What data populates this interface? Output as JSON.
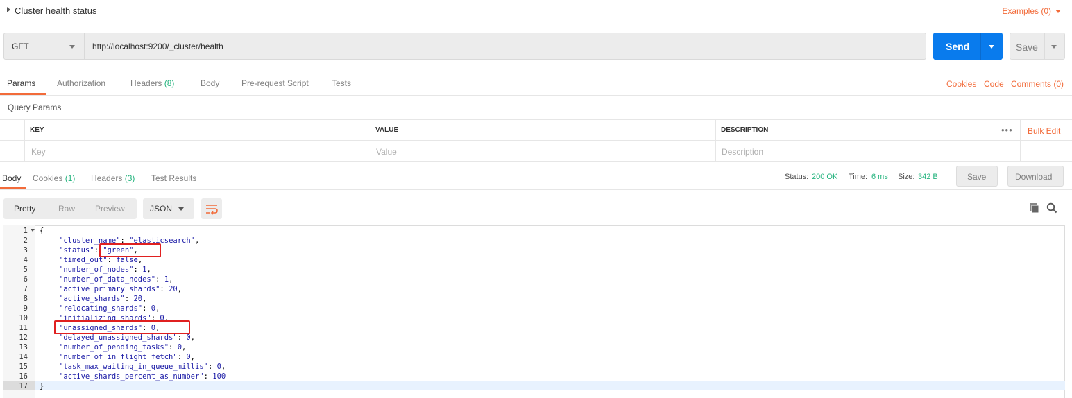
{
  "header": {
    "title": "Cluster health status",
    "examples": "Examples (0)"
  },
  "request": {
    "method": "GET",
    "url": "http://localhost:9200/_cluster/health",
    "send_label": "Send",
    "save_label": "Save"
  },
  "request_tabs": [
    {
      "label": "Params"
    },
    {
      "label": "Authorization"
    },
    {
      "label": "Headers",
      "count": "(8)"
    },
    {
      "label": "Body"
    },
    {
      "label": "Pre-request Script"
    },
    {
      "label": "Tests"
    }
  ],
  "request_links": {
    "cookies": "Cookies",
    "code": "Code",
    "comments": "Comments (0)"
  },
  "query_params": {
    "title": "Query Params",
    "columns": [
      "KEY",
      "VALUE",
      "DESCRIPTION"
    ],
    "placeholders": [
      "Key",
      "Value",
      "Description"
    ],
    "bulk_edit": "Bulk Edit",
    "more": "•••"
  },
  "response_tabs": [
    {
      "label": "Body"
    },
    {
      "label": "Cookies",
      "count": "(1)"
    },
    {
      "label": "Headers",
      "count": "(3)"
    },
    {
      "label": "Test Results"
    }
  ],
  "response_status": {
    "status_label": "Status:",
    "status": "200 OK",
    "time_label": "Time:",
    "time": "6 ms",
    "size_label": "Size:",
    "size": "342 B",
    "save_label": "Save",
    "download_label": "Download"
  },
  "view": {
    "options": [
      "Pretty",
      "Raw",
      "Preview"
    ],
    "active": "Pretty",
    "format": "JSON"
  },
  "code_lines": [
    {
      "n": "1",
      "text": "{"
    },
    {
      "n": "2",
      "key": "\"cluster_name\"",
      "val": "\"elasticsearch\"",
      "tail": ","
    },
    {
      "n": "3",
      "key": "\"status\"",
      "val": "\"green\"",
      "tail": ","
    },
    {
      "n": "4",
      "key": "\"timed_out\"",
      "val": "false",
      "tail": ","
    },
    {
      "n": "5",
      "key": "\"number_of_nodes\"",
      "val": "1",
      "tail": ","
    },
    {
      "n": "6",
      "key": "\"number_of_data_nodes\"",
      "val": "1",
      "tail": ","
    },
    {
      "n": "7",
      "key": "\"active_primary_shards\"",
      "val": "20",
      "tail": ","
    },
    {
      "n": "8",
      "key": "\"active_shards\"",
      "val": "20",
      "tail": ","
    },
    {
      "n": "9",
      "key": "\"relocating_shards\"",
      "val": "0",
      "tail": ","
    },
    {
      "n": "10",
      "key": "\"initializing_shards\"",
      "val": "0",
      "tail": ","
    },
    {
      "n": "11",
      "key": "\"unassigned_shards\"",
      "val": "0",
      "tail": ","
    },
    {
      "n": "12",
      "key": "\"delayed_unassigned_shards\"",
      "val": "0",
      "tail": ","
    },
    {
      "n": "13",
      "key": "\"number_of_pending_tasks\"",
      "val": "0",
      "tail": ","
    },
    {
      "n": "14",
      "key": "\"number_of_in_flight_fetch\"",
      "val": "0",
      "tail": ","
    },
    {
      "n": "15",
      "key": "\"task_max_waiting_in_queue_millis\"",
      "val": "0",
      "tail": ","
    },
    {
      "n": "16",
      "key": "\"active_shards_percent_as_number\"",
      "val": "100",
      "tail": ""
    },
    {
      "n": "17",
      "text": "}"
    }
  ],
  "colors": {
    "accent": "#f26b3a",
    "send": "#097bed",
    "success": "#26b47f",
    "annotation": "#e02020"
  }
}
